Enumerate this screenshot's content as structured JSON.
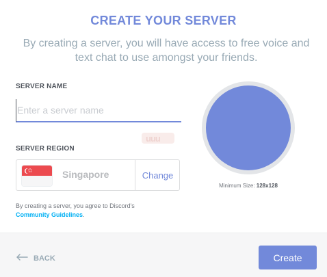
{
  "header": {
    "title": "CREATE YOUR SERVER",
    "subtitle": "By creating a server, you will have access to free voice and text chat to use amongst your friends."
  },
  "server_name": {
    "label": "SERVER NAME",
    "value": "",
    "placeholder": "Enter a server name"
  },
  "server_region": {
    "label": "SERVER REGION",
    "flag_icon": "singapore-flag-icon",
    "region": "Singapore",
    "change_label": "Change"
  },
  "server_icon": {
    "color": "#7289da",
    "min_size_label": "Minimum Size:",
    "min_size_value": "128x128"
  },
  "watermark": "uuu",
  "terms": {
    "text": "By creating a server, you agree to Discord's",
    "link": "Community Guidelines",
    "suffix": "."
  },
  "footer": {
    "back_label": "BACK",
    "back_icon": "arrow-left-icon",
    "create_label": "Create"
  },
  "colors": {
    "accent": "#7289da",
    "link": "#00b0f4",
    "muted": "#99aab5"
  }
}
